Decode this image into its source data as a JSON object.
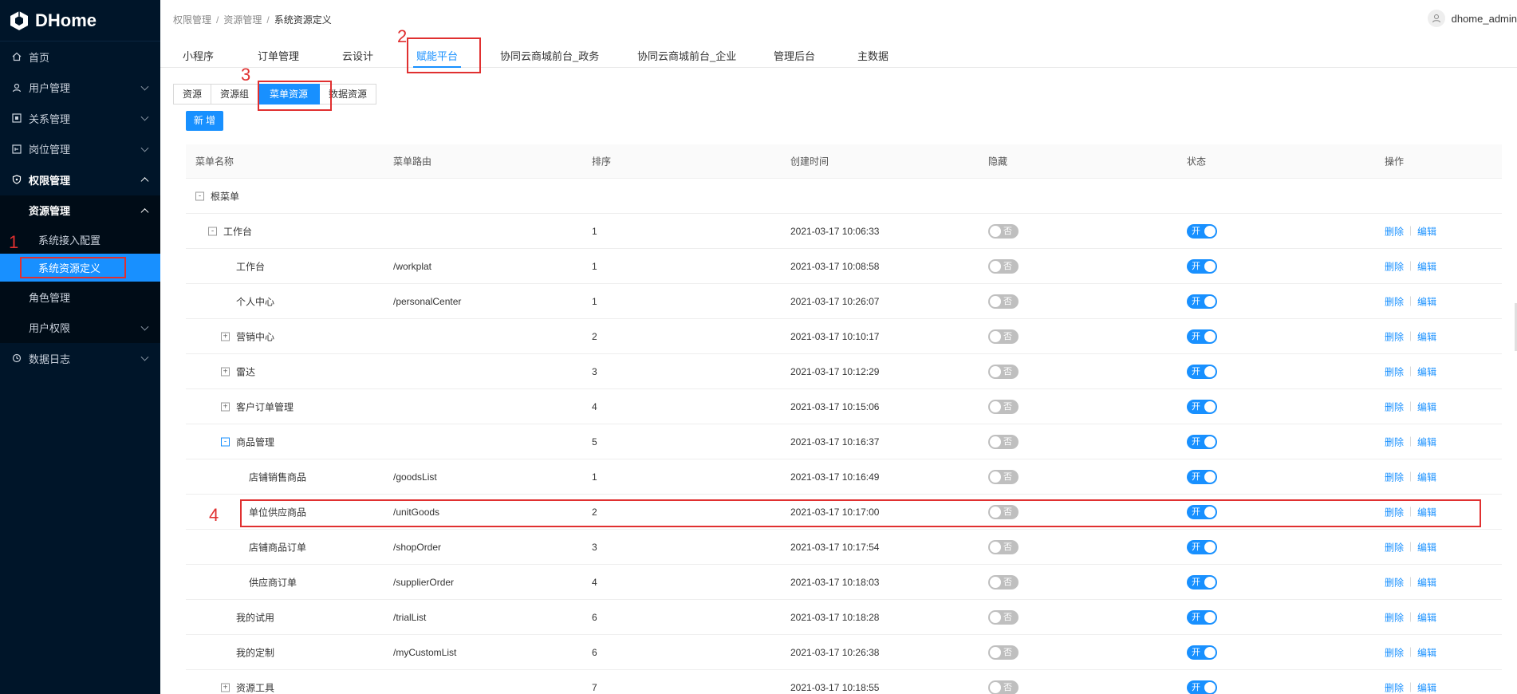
{
  "brand": {
    "name": "DHome"
  },
  "sidebar": {
    "items": [
      {
        "label": "首页"
      },
      {
        "label": "用户管理"
      },
      {
        "label": "关系管理"
      },
      {
        "label": "岗位管理"
      },
      {
        "label": "权限管理"
      },
      {
        "label": "资源管理"
      },
      {
        "label": "系统接入配置"
      },
      {
        "label": "系统资源定义"
      },
      {
        "label": "角色管理"
      },
      {
        "label": "用户权限"
      },
      {
        "label": "数据日志"
      }
    ]
  },
  "breadcrumb": {
    "items": [
      "权限管理",
      "资源管理",
      "系统资源定义"
    ]
  },
  "user": {
    "name": "dhome_admin"
  },
  "top_tabs": [
    "小程序",
    "订单管理",
    "云设计",
    "赋能平台",
    "协同云商城前台_政务",
    "协同云商城前台_企业",
    "管理后台",
    "主数据"
  ],
  "sub_tabs": [
    "资源",
    "资源组",
    "菜单资源",
    "数据资源"
  ],
  "add_button": "新 增",
  "annotations": [
    "1",
    "2",
    "3",
    "4"
  ],
  "table": {
    "headers": [
      "菜单名称",
      "菜单路由",
      "排序",
      "创建时间",
      "隐藏",
      "状态",
      "操作"
    ],
    "rows": [
      {
        "name": "根菜单",
        "route": "",
        "order": "",
        "time": "",
        "toggle": "-"
      },
      {
        "name": "工作台",
        "route": "",
        "order": "1",
        "time": "2021-03-17 10:06:33",
        "toggle": "-"
      },
      {
        "name": "工作台",
        "route": "/workplat",
        "order": "1",
        "time": "2021-03-17 10:08:58"
      },
      {
        "name": "个人中心",
        "route": "/personalCenter",
        "order": "1",
        "time": "2021-03-17 10:26:07"
      },
      {
        "name": "营销中心",
        "route": "",
        "order": "2",
        "time": "2021-03-17 10:10:17",
        "toggle": "+"
      },
      {
        "name": "雷达",
        "route": "",
        "order": "3",
        "time": "2021-03-17 10:12:29",
        "toggle": "+"
      },
      {
        "name": "客户订单管理",
        "route": "",
        "order": "4",
        "time": "2021-03-17 10:15:06",
        "toggle": "+"
      },
      {
        "name": "商品管理",
        "route": "",
        "order": "5",
        "time": "2021-03-17 10:16:37",
        "toggle": "-"
      },
      {
        "name": "店铺销售商品",
        "route": "/goodsList",
        "order": "1",
        "time": "2021-03-17 10:16:49"
      },
      {
        "name": "单位供应商品",
        "route": "/unitGoods",
        "order": "2",
        "time": "2021-03-17 10:17:00"
      },
      {
        "name": "店铺商品订单",
        "route": "/shopOrder",
        "order": "3",
        "time": "2021-03-17 10:17:54"
      },
      {
        "name": "供应商订单",
        "route": "/supplierOrder",
        "order": "4",
        "time": "2021-03-17 10:18:03"
      },
      {
        "name": "我的试用",
        "route": "/trialList",
        "order": "6",
        "time": "2021-03-17 10:18:28"
      },
      {
        "name": "我的定制",
        "route": "/myCustomList",
        "order": "6",
        "time": "2021-03-17 10:26:38"
      },
      {
        "name": "资源工具",
        "route": "",
        "order": "7",
        "time": "2021-03-17 10:18:55",
        "toggle": "+"
      }
    ],
    "hidden_label": "否",
    "status_label": "开",
    "delete_label": "删除",
    "edit_label": "编辑"
  },
  "colors": {
    "accent": "#1890ff",
    "sidebar_bg": "#001529",
    "annotation": "#e03030"
  }
}
